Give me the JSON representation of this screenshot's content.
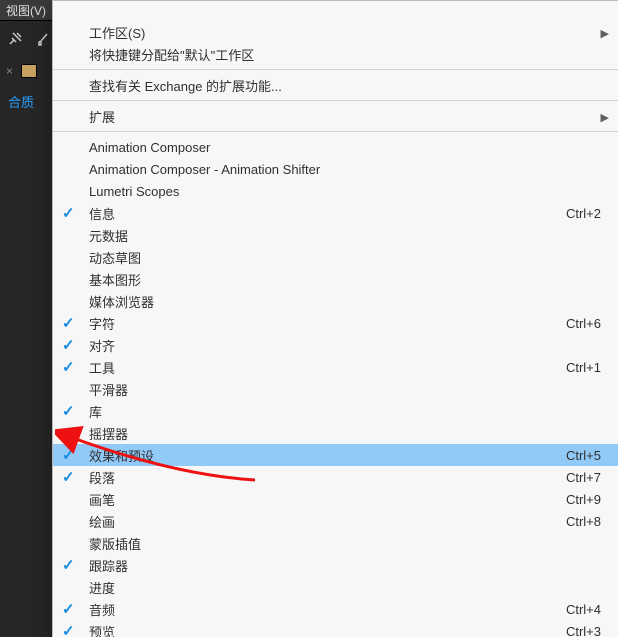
{
  "visible_menubar_item": "视图(V)",
  "comp_label": "合质",
  "menu": {
    "groups": [
      [
        {
          "id": "workspace",
          "label": "工作区(S)",
          "has_sub": true
        },
        {
          "id": "assign-shortcuts",
          "label": "将快捷键分配给\"默认\"工作区"
        }
      ],
      [
        {
          "id": "find-exchange-ext",
          "label": "查找有关 Exchange 的扩展功能..."
        }
      ],
      [
        {
          "id": "extensions",
          "label": "扩展",
          "has_sub": true
        }
      ],
      [
        {
          "id": "anim-composer",
          "label": "Animation Composer"
        },
        {
          "id": "anim-composer-shifter",
          "label": "Animation Composer - Animation Shifter"
        },
        {
          "id": "lumetri",
          "label": "Lumetri Scopes"
        },
        {
          "id": "info",
          "label": "信息",
          "checked": true,
          "shortcut": "Ctrl+2"
        },
        {
          "id": "metadata",
          "label": "元数据"
        },
        {
          "id": "motion-sketch",
          "label": "动态草图"
        },
        {
          "id": "essential-graphics",
          "label": "基本图形"
        },
        {
          "id": "media-browser",
          "label": "媒体浏览器"
        },
        {
          "id": "character",
          "label": "字符",
          "checked": true,
          "shortcut": "Ctrl+6"
        },
        {
          "id": "align",
          "label": "对齐",
          "checked": true
        },
        {
          "id": "tools",
          "label": "工具",
          "checked": true,
          "shortcut": "Ctrl+1"
        },
        {
          "id": "smoother",
          "label": "平滑器"
        },
        {
          "id": "library",
          "label": "库",
          "checked": true
        },
        {
          "id": "wiggler",
          "label": "摇摆器"
        },
        {
          "id": "effects-presets",
          "label": "效果和预设",
          "checked": true,
          "shortcut": "Ctrl+5",
          "selected": true
        },
        {
          "id": "paragraph",
          "label": "段落",
          "checked": true,
          "shortcut": "Ctrl+7"
        },
        {
          "id": "brushes",
          "label": "画笔",
          "shortcut": "Ctrl+9"
        },
        {
          "id": "paint",
          "label": "绘画",
          "shortcut": "Ctrl+8"
        },
        {
          "id": "mask-interp",
          "label": "蒙版插值"
        },
        {
          "id": "tracker",
          "label": "跟踪器",
          "checked": true
        },
        {
          "id": "progress",
          "label": "进度"
        },
        {
          "id": "audio",
          "label": "音频",
          "checked": true,
          "shortcut": "Ctrl+4"
        },
        {
          "id": "preview",
          "label": "预览",
          "checked": true,
          "shortcut": "Ctrl+3"
        }
      ]
    ]
  }
}
